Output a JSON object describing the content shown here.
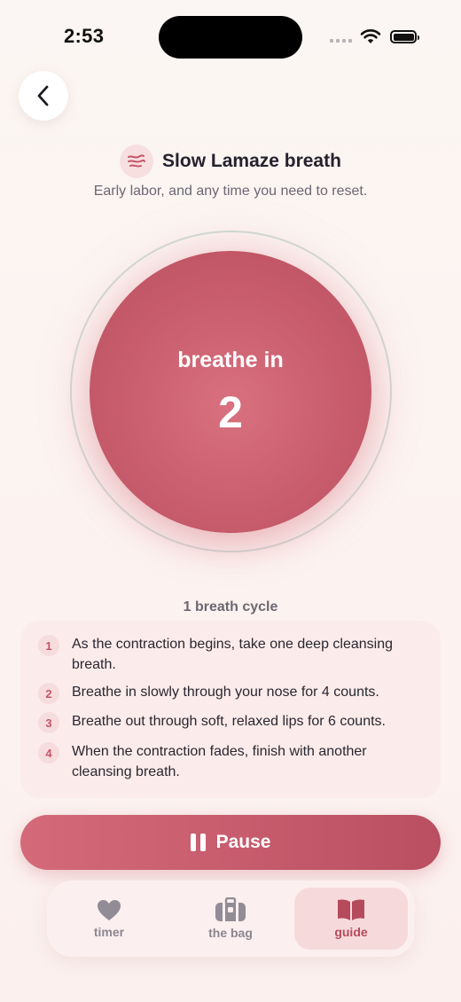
{
  "status_bar": {
    "time": "2:53"
  },
  "header": {
    "title": "Slow Lamaze breath",
    "subtitle": "Early labor, and any time you need to reset.",
    "icon": "breath-wind-icon"
  },
  "breath": {
    "phase": "breathe in",
    "count": "2"
  },
  "cycle": {
    "label": "1 breath cycle",
    "steps": [
      {
        "num": "1",
        "text": "As the contraction begins, take one deep cleansing breath."
      },
      {
        "num": "2",
        "text": "Breathe in slowly through your nose for 4 counts."
      },
      {
        "num": "3",
        "text": "Breathe out through soft, relaxed lips for 6 counts."
      },
      {
        "num": "4",
        "text": "When the contraction fades, finish with another cleansing breath."
      }
    ]
  },
  "controls": {
    "pause_label": "Pause"
  },
  "tabs": [
    {
      "label": "timer",
      "icon": "heart-icon",
      "active": false
    },
    {
      "label": "the bag",
      "icon": "bag-icon",
      "active": false
    },
    {
      "label": "guide",
      "icon": "book-icon",
      "active": true
    }
  ],
  "colors": {
    "accent": "#c75c6c",
    "accent_light": "#f6dadb",
    "ring": "#d0dcd6",
    "text_muted": "#6d6773"
  }
}
